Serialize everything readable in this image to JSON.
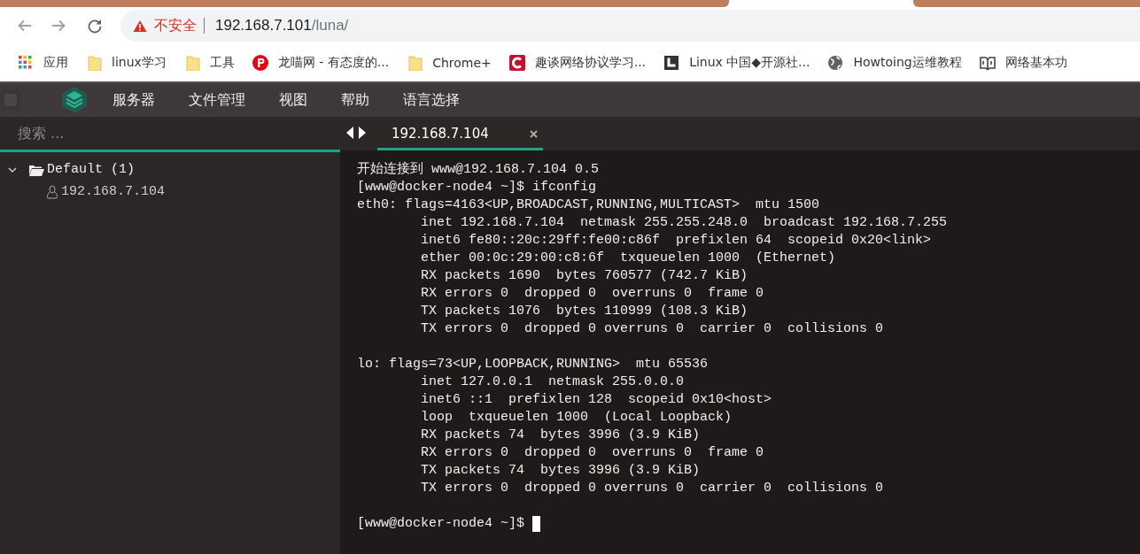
{
  "browser": {
    "nav_buttons": [
      {
        "kind": "back",
        "disabled": true
      },
      {
        "kind": "forward",
        "disabled": true
      },
      {
        "kind": "reload",
        "disabled": false
      }
    ],
    "address": {
      "security": "不安全",
      "host": "192.168.7.101",
      "path": "/luna/"
    },
    "bookmarks": [
      {
        "kind": "apps",
        "label": "应用"
      },
      {
        "kind": "folder",
        "label": "linux学习"
      },
      {
        "kind": "folder",
        "label": "工具"
      },
      {
        "kind": "p",
        "label": "龙喵网 - 有态度的..."
      },
      {
        "kind": "folder",
        "label": "Chrome+"
      },
      {
        "kind": "c",
        "label": "趣谈网络协议学习..."
      },
      {
        "kind": "square",
        "label": "Linux 中国◆开源社..."
      },
      {
        "kind": "globe",
        "label": "Howtoing运维教程"
      },
      {
        "kind": "book",
        "label": "网络基本功"
      }
    ]
  },
  "menu": [
    "服务器",
    "文件管理",
    "视图",
    "帮助",
    "语言选择"
  ],
  "sidebar": {
    "search": {
      "placeholder": "搜索 ..."
    },
    "tree": [
      {
        "label": "Default (1)",
        "expanded": true,
        "children": [
          {
            "label": "192.168.7.104"
          }
        ]
      }
    ]
  },
  "tabs": [
    {
      "label": "192.168.7.104",
      "selected": true
    }
  ],
  "terminal": {
    "lines": [
      {
        "kind": "output",
        "text": "开始连接到 www@192.168.7.104 0.5"
      },
      {
        "kind": "output",
        "text": "[www@docker-node4 ~]$ ifconfig"
      },
      {
        "kind": "output",
        "text": "eth0: flags=4163<UP,BROADCAST,RUNNING,MULTICAST>  mtu 1500"
      },
      {
        "kind": "output",
        "text": "        inet 192.168.7.104  netmask 255.255.248.0  broadcast 192.168.7.255"
      },
      {
        "kind": "output",
        "text": "        inet6 fe80::20c:29ff:fe00:c86f  prefixlen 64  scopeid 0x20<link>"
      },
      {
        "kind": "output",
        "text": "        ether 00:0c:29:00:c8:6f  txqueuelen 1000  (Ethernet)"
      },
      {
        "kind": "output",
        "text": "        RX packets 1690  bytes 760577 (742.7 KiB)"
      },
      {
        "kind": "output",
        "text": "        RX errors 0  dropped 0  overruns 0  frame 0"
      },
      {
        "kind": "output",
        "text": "        TX packets 1076  bytes 110999 (108.3 KiB)"
      },
      {
        "kind": "output",
        "text": "        TX errors 0  dropped 0 overruns 0  carrier 0  collisions 0"
      },
      {
        "kind": "blank"
      },
      {
        "kind": "output",
        "text": "lo: flags=73<UP,LOOPBACK,RUNNING>  mtu 65536"
      },
      {
        "kind": "output",
        "text": "        inet 127.0.0.1  netmask 255.0.0.0"
      },
      {
        "kind": "output",
        "text": "        inet6 ::1  prefixlen 128  scopeid 0x10<host>"
      },
      {
        "kind": "output",
        "text": "        loop  txqueuelen 1000  (Local Loopback)"
      },
      {
        "kind": "output",
        "text": "        RX packets 74  bytes 3996 (3.9 KiB)"
      },
      {
        "kind": "output",
        "text": "        RX errors 0  dropped 0  overruns 0  frame 0"
      },
      {
        "kind": "output",
        "text": "        TX packets 74  bytes 3996 (3.9 KiB)"
      },
      {
        "kind": "output",
        "text": "        TX errors 0  dropped 0 overruns 0  carrier 0  collisions 0"
      },
      {
        "kind": "blank"
      },
      {
        "kind": "prompt",
        "text": "[www@docker-node4 ~]$",
        "cursor": true
      }
    ]
  }
}
